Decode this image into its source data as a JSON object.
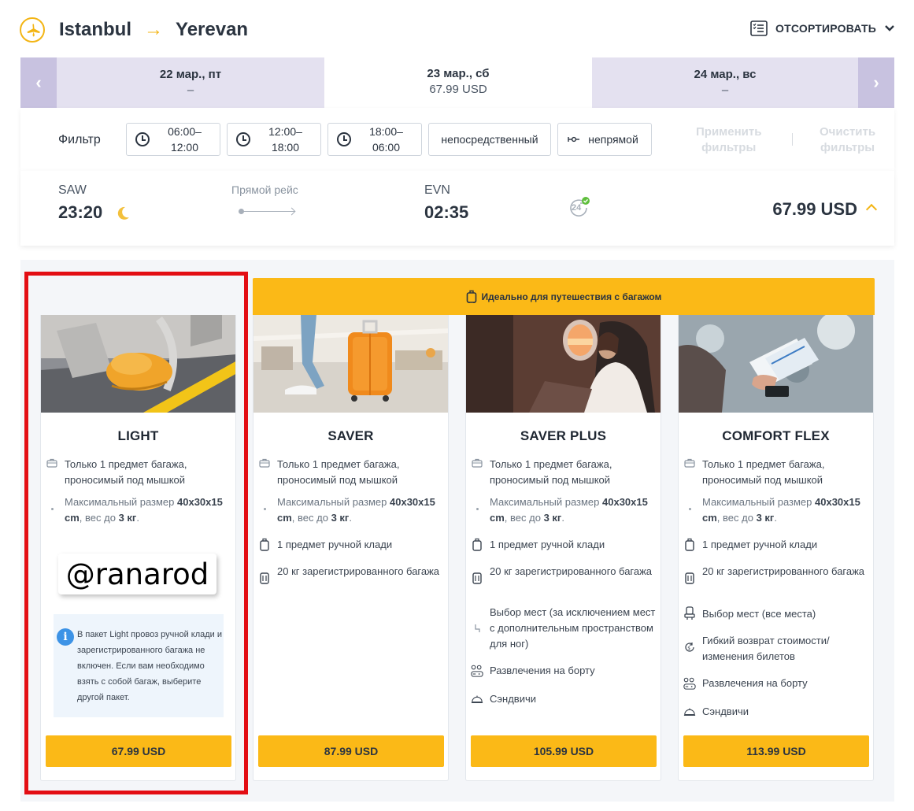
{
  "header": {
    "origin": "Istanbul",
    "arrow": "→",
    "destination": "Yerevan",
    "sort_label": "ОТСОРТИРОВАТЬ",
    "icons": [
      "plane-icon",
      "sort-list-icon",
      "chevron-down-icon"
    ]
  },
  "dates": [
    {
      "date": "22 мар., пт",
      "price": "–"
    },
    {
      "date": "23 мар., сб",
      "price": "67.99 USD"
    },
    {
      "date": "24 мар., вс",
      "price": "–"
    }
  ],
  "date_nav": {
    "prev": "‹",
    "next": "›"
  },
  "filters": {
    "label": "Фильтр",
    "options": [
      {
        "line1": "06:00–",
        "line2": "12:00"
      },
      {
        "line1": "12:00–",
        "line2": "18:00"
      },
      {
        "line1": "18:00–",
        "line2": "06:00"
      }
    ],
    "direct": "непосредственный",
    "indirect": "непрямой",
    "apply_line1": "Применить",
    "apply_line2": "фильтры",
    "clear_line1": "Очистить",
    "clear_line2": "фильтры"
  },
  "flight": {
    "from_code": "SAW",
    "from_time": "23:20",
    "flight_type": "Прямой рейс",
    "to_code": "EVN",
    "to_time": "02:35",
    "hours_badge": "24",
    "price": "67.99 USD"
  },
  "banner": "Идеально для путешествия с багажом",
  "fares": [
    {
      "name": "LIGHT",
      "price": "67.99 USD",
      "features": [
        {
          "icon": "bag-icon",
          "text": "Только 1 предмет багажа, проносимый под мышкой"
        },
        {
          "icon": "dot-icon",
          "text_pre": "Максимальный размер ",
          "text_b1": "40x30x15 cm",
          "text_mid": ", вес до ",
          "text_b2": "3 кг",
          "text_post": "."
        }
      ],
      "info": "В пакет Light провоз ручной клади и зарегистрированного багажа не включен. Если вам необходимо взять с собой багаж, выберите другой пакет."
    },
    {
      "name": "SAVER",
      "price": "87.99 USD",
      "features": [
        {
          "icon": "bag-icon",
          "text": "Только 1 предмет багажа, проносимый под мышкой"
        },
        {
          "icon": "dot-icon",
          "text_pre": "Максимальный размер ",
          "text_b1": "40x30x15 cm",
          "text_mid": ", вес до ",
          "text_b2": "3 кг",
          "text_post": "."
        },
        {
          "icon": "carry-on-icon",
          "text": "1 предмет ручной клади"
        },
        {
          "icon": "suitcase-icon",
          "text": "20 кг зарегистрированного багажа"
        }
      ]
    },
    {
      "name": "SAVER PLUS",
      "price": "105.99 USD",
      "features": [
        {
          "icon": "bag-icon",
          "text": "Только 1 предмет багажа, проносимый под мышкой"
        },
        {
          "icon": "dot-icon",
          "text_pre": "Максимальный размер ",
          "text_b1": "40x30x15 cm",
          "text_mid": ", вес до ",
          "text_b2": "3 кг",
          "text_post": "."
        },
        {
          "icon": "carry-on-icon",
          "text": "1 предмет ручной клади"
        },
        {
          "icon": "suitcase-icon",
          "text": "20 кг зарегистрированного багажа"
        },
        {
          "icon": "seat-icon",
          "text": "Выбор мест (за исключением мест с дополнительным пространством для ног)"
        },
        {
          "icon": "entertainment-icon",
          "text": "Развлечения на борту"
        },
        {
          "icon": "meal-icon",
          "text": "Сэндвичи"
        }
      ]
    },
    {
      "name": "COMFORT FLEX",
      "price": "113.99 USD",
      "features": [
        {
          "icon": "bag-icon",
          "text": "Только 1 предмет багажа, проносимый под мышкой"
        },
        {
          "icon": "dot-icon",
          "text_pre": "Максимальный размер ",
          "text_b1": "40x30x15 cm",
          "text_mid": ", вес до ",
          "text_b2": "3 кг",
          "text_post": "."
        },
        {
          "icon": "carry-on-icon",
          "text": "1 предмет ручной клади"
        },
        {
          "icon": "suitcase-icon",
          "text": "20 кг зарегистрированного багажа"
        },
        {
          "icon": "seat-icon",
          "text": "Выбор мест (все места)"
        },
        {
          "icon": "refund-icon",
          "text": "Гибкий возврат стоимости/ изменения билетов"
        },
        {
          "icon": "entertainment-icon",
          "text": "Развлечения на борту"
        },
        {
          "icon": "meal-icon",
          "text": "Сэндвичи"
        }
      ]
    }
  ],
  "watermark": "@ranarod",
  "colors": {
    "accent": "#fbb917",
    "brand_purple": "#c8c2e0",
    "highlight": "#e30e14",
    "info": "#3d93e6"
  }
}
